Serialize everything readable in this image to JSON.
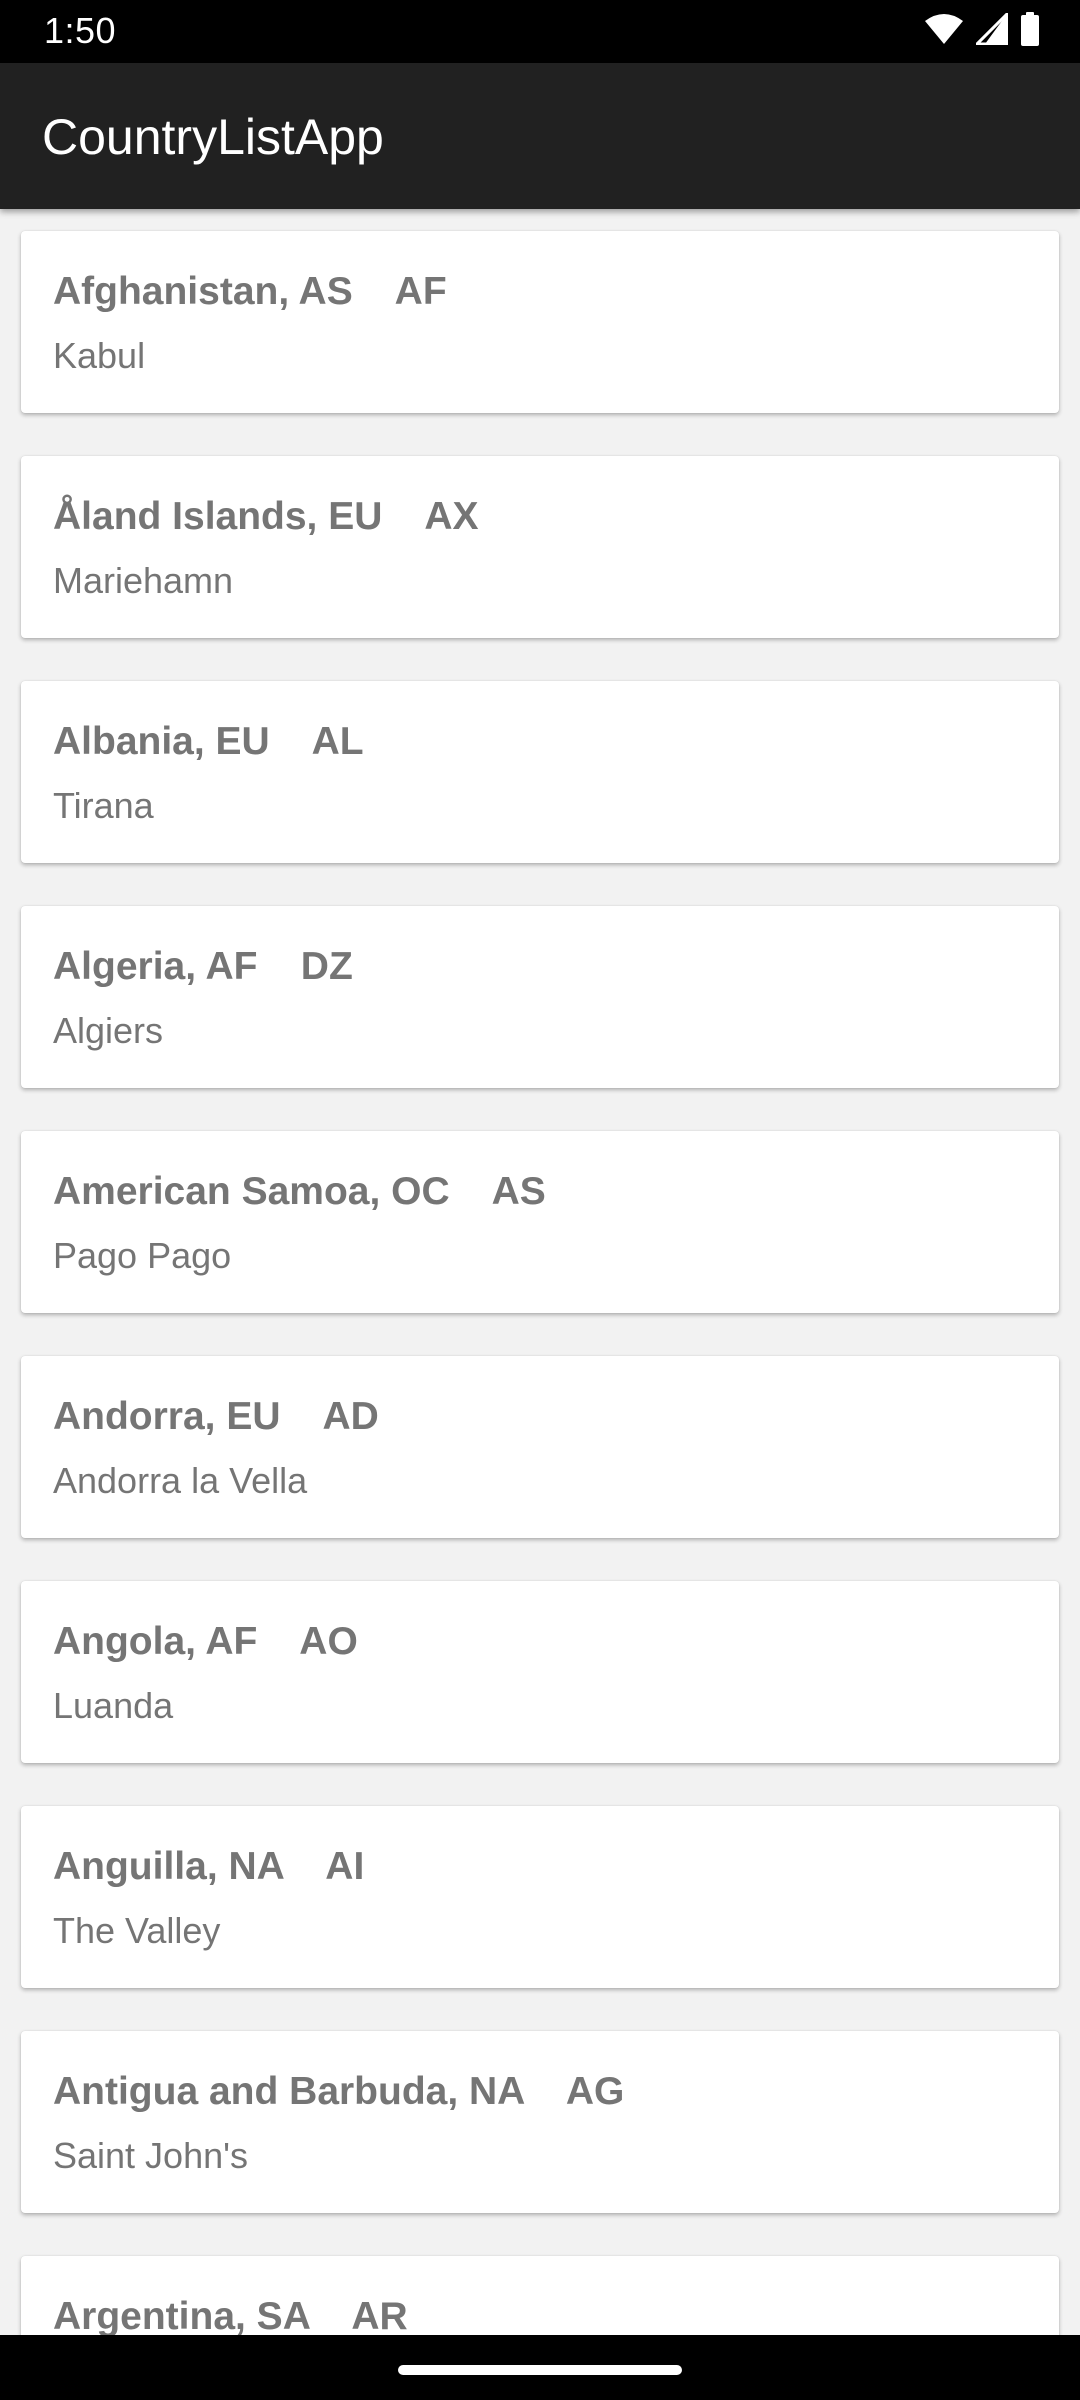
{
  "status_bar": {
    "time": "1:50",
    "icons": [
      "wifi-icon",
      "cellular-signal-icon",
      "battery-icon"
    ]
  },
  "app_bar": {
    "title": "CountryListApp"
  },
  "countries": [
    {
      "name_region": "Afghanistan, AS",
      "code": "AF",
      "capital": "Kabul"
    },
    {
      "name_region": "Åland Islands, EU",
      "code": "AX",
      "capital": "Mariehamn"
    },
    {
      "name_region": "Albania, EU",
      "code": "AL",
      "capital": "Tirana"
    },
    {
      "name_region": "Algeria, AF",
      "code": "DZ",
      "capital": "Algiers"
    },
    {
      "name_region": "American Samoa, OC",
      "code": "AS",
      "capital": "Pago Pago"
    },
    {
      "name_region": "Andorra, EU",
      "code": "AD",
      "capital": "Andorra la Vella"
    },
    {
      "name_region": "Angola, AF",
      "code": "AO",
      "capital": "Luanda"
    },
    {
      "name_region": "Anguilla, NA",
      "code": "AI",
      "capital": "The Valley"
    },
    {
      "name_region": "Antigua and Barbuda, NA",
      "code": "AG",
      "capital": "Saint John's"
    },
    {
      "name_region": "Argentina, SA",
      "code": "AR",
      "capital": ""
    }
  ],
  "colors": {
    "status_bar": "#000000",
    "app_bar": "#212121",
    "background": "#f2f2f2",
    "card": "#ffffff",
    "card_text": "#757575"
  }
}
